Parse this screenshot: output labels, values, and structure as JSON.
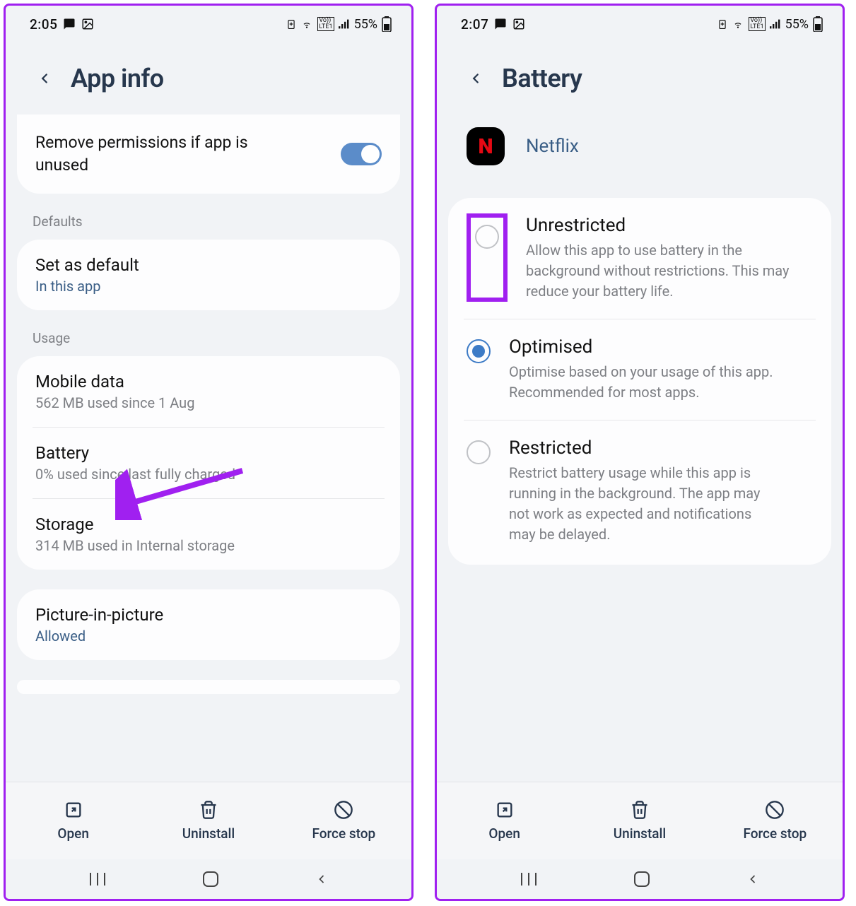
{
  "left": {
    "status": {
      "time": "2:05",
      "battery_pct": "55%"
    },
    "title": "App info",
    "permission_row": {
      "label": "Remove permissions if app is unused",
      "toggle_on": true
    },
    "sections": {
      "defaults_label": "Defaults",
      "set_default": {
        "title": "Set as default",
        "sub": "In this app"
      },
      "usage_label": "Usage",
      "mobile_data": {
        "title": "Mobile data",
        "sub": "562 MB used since 1 Aug"
      },
      "battery": {
        "title": "Battery",
        "sub": "0% used since last fully charged"
      },
      "storage": {
        "title": "Storage",
        "sub": "314 MB used in Internal storage"
      },
      "pip": {
        "title": "Picture-in-picture",
        "sub": "Allowed"
      }
    },
    "actions": {
      "open": "Open",
      "uninstall": "Uninstall",
      "force_stop": "Force stop"
    }
  },
  "right": {
    "status": {
      "time": "2:07",
      "battery_pct": "55%"
    },
    "title": "Battery",
    "app_name": "Netflix",
    "options": {
      "unrestricted": {
        "title": "Unrestricted",
        "desc": "Allow this app to use battery in the background without restrictions. This may reduce your battery life.",
        "selected": false
      },
      "optimised": {
        "title": "Optimised",
        "desc": "Optimise based on your usage of this app. Recommended for most apps.",
        "selected": true
      },
      "restricted": {
        "title": "Restricted",
        "desc": "Restrict battery usage while this app is running in the background. The app may not work as expected and notifications may be delayed.",
        "selected": false
      }
    },
    "actions": {
      "open": "Open",
      "uninstall": "Uninstall",
      "force_stop": "Force stop"
    }
  }
}
